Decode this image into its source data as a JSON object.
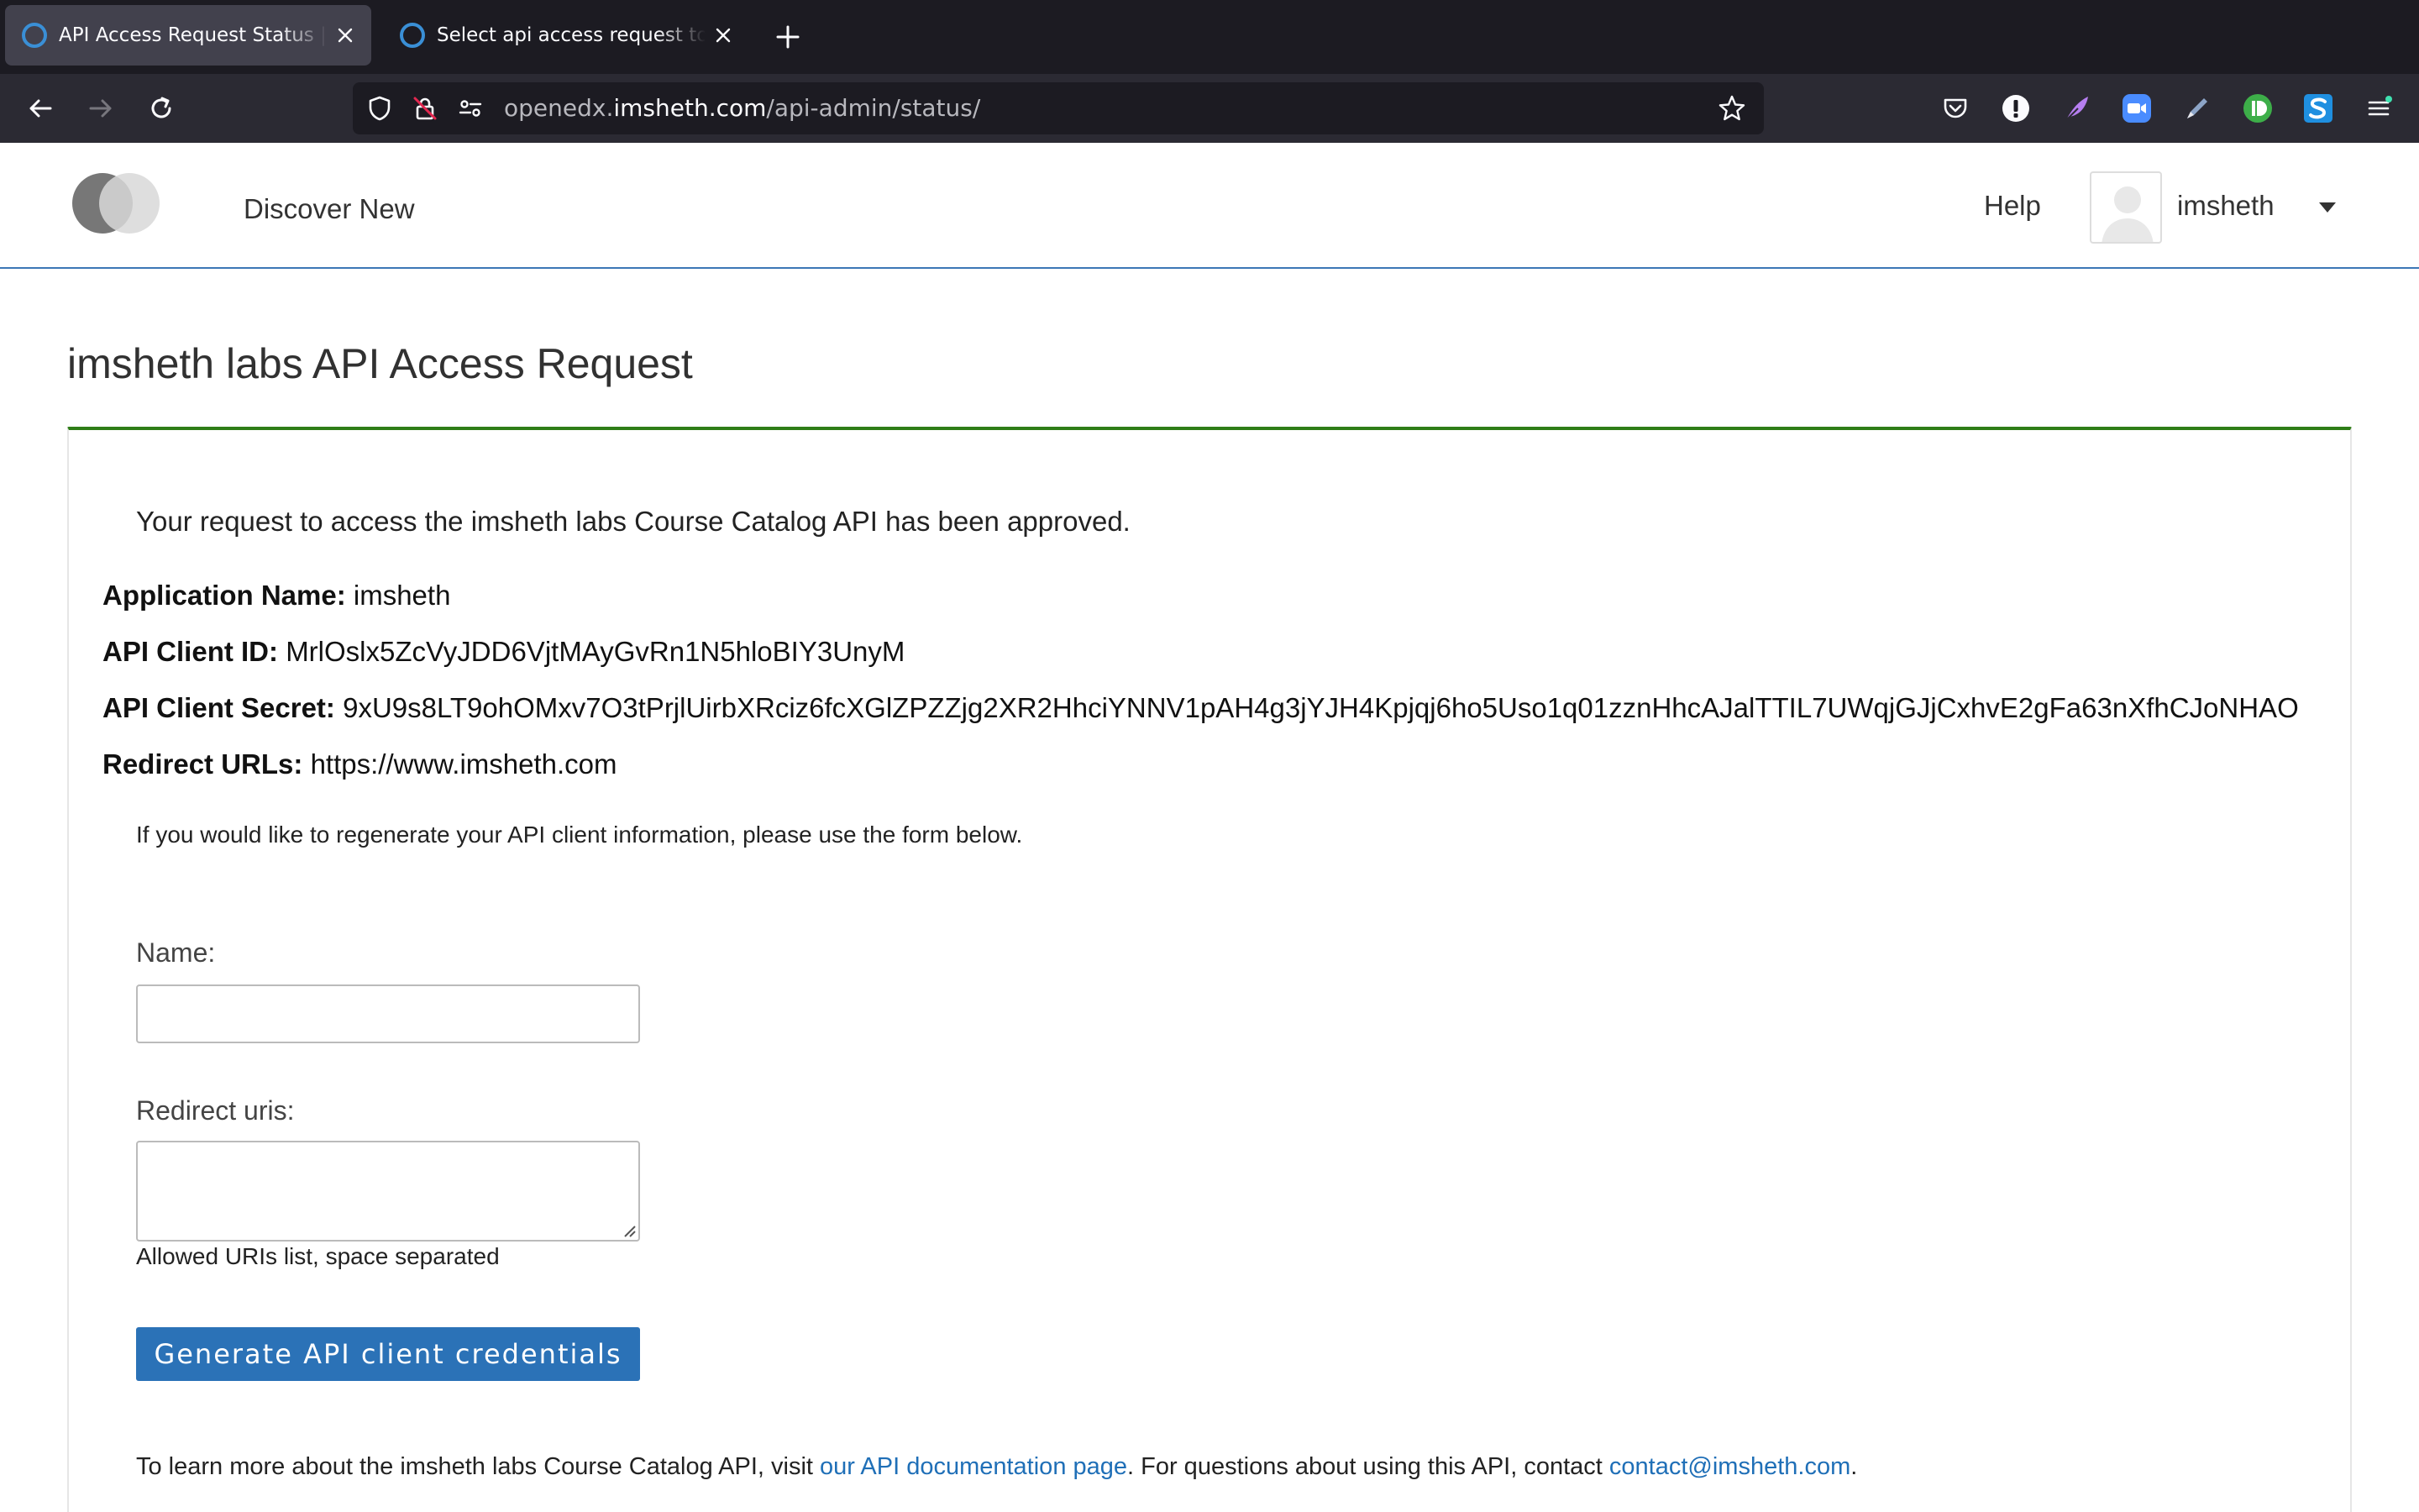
{
  "browser": {
    "tabs": [
      {
        "title": "API Access Request Status | imsheth",
        "active": true
      },
      {
        "title": "Select api access request to change",
        "active": false
      }
    ],
    "url": {
      "prefix": "openedx.",
      "domain": "imsheth.com",
      "path": "/api-admin/status/"
    },
    "extensions": [
      "pocket-icon",
      "info-icon",
      "feather-icon",
      "zoom-icon",
      "pen-icon",
      "d-icon",
      "s-icon"
    ]
  },
  "header": {
    "nav_link": "Discover New",
    "help": "Help",
    "username": "imsheth"
  },
  "main": {
    "title": "imsheth labs API Access Request",
    "status_message": "Your request to access the imsheth labs Course Catalog API has been approved.",
    "details": {
      "app_name_label": "Application Name:",
      "app_name": "imsheth",
      "client_id_label": "API Client ID:",
      "client_id": "MrlOslx5ZcVyJDD6VjtMAyGvRn1N5hloBIY3UnyM",
      "client_secret_label": "API Client Secret:",
      "client_secret": "9xU9s8LT9ohOMxv7O3tPrjlUirbXRciz6fcXGlZPZZjg2XR2HhciYNNV1pAH4g3jYJH4Kpjqj6ho5Uso1q01zznHhcAJalTTIL7UWqjGJjCxhvE2gFa63nXfhCJoNHAO",
      "redirect_label": "Redirect URLs:",
      "redirect": "https://www.imsheth.com"
    },
    "regen_message": "If you would like to regenerate your API client information, please use the form below.",
    "form": {
      "name_label": "Name:",
      "name_value": "",
      "uris_label": "Redirect uris:",
      "uris_value": "",
      "uris_help": "Allowed URIs list, space separated",
      "submit_label": "Generate API client credentials"
    },
    "footer": {
      "text1": "To learn more about the imsheth labs Course Catalog API, visit ",
      "doc_link": "our API documentation page",
      "text2": ". For questions about using this API, contact ",
      "contact_link": "contact@imsheth.com",
      "text3": "."
    }
  }
}
